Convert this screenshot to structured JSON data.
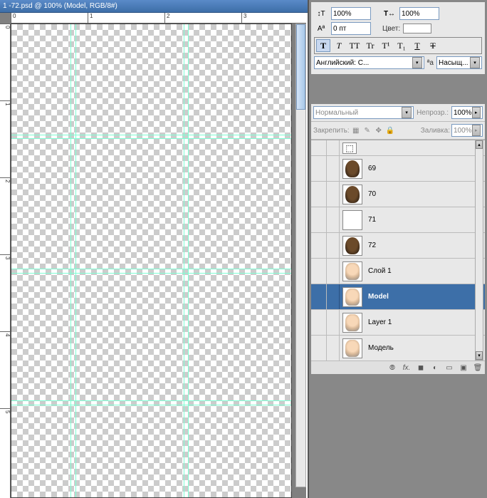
{
  "titlebar": {
    "title": "1 -72.psd @ 100% (Model, RGB/8#)",
    "minimize": "_",
    "maximize": "❐",
    "close": "×"
  },
  "ruler": {
    "top": [
      "0",
      "1",
      "2",
      "3"
    ],
    "left": [
      "0",
      "1",
      "2",
      "3",
      "4",
      "5"
    ]
  },
  "character": {
    "tracking_value": "100%",
    "scale_value": "100%",
    "baseline_label": "Aª",
    "baseline_value": "0 пт",
    "color_label": "Цвет:",
    "style_buttons": [
      "T",
      "T",
      "TT",
      "Tr",
      "T¹",
      "T₁",
      "T",
      "Ŧ"
    ],
    "lang_label": "Английский: С...",
    "aa_label": "ªа",
    "aa_value": "Насыщ..."
  },
  "layers": {
    "blend_mode": "Нормальный",
    "opacity_label": "Непрозр.:",
    "opacity_value": "100%",
    "lock_label": "Закрепить:",
    "fill_label": "Заливка:",
    "fill_value": "100%",
    "items": [
      {
        "name": "69",
        "thumb": "hair"
      },
      {
        "name": "70",
        "thumb": "hair"
      },
      {
        "name": "71",
        "thumb": "checker"
      },
      {
        "name": "72",
        "thumb": "hair"
      },
      {
        "name": "Слой 1",
        "thumb": "face"
      },
      {
        "name": "Model",
        "thumb": "face",
        "selected": true
      },
      {
        "name": "Layer 1",
        "thumb": "face"
      },
      {
        "name": "Модель",
        "thumb": "face",
        "locked": true
      }
    ],
    "footer_icons": [
      "link",
      "fx",
      "mask",
      "adj",
      "group",
      "new",
      "trash"
    ]
  }
}
